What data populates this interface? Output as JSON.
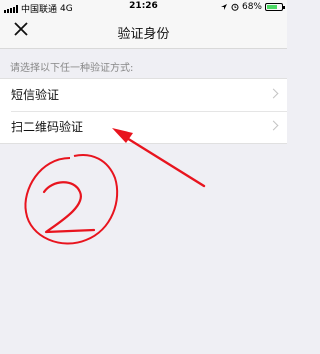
{
  "status_bar": {
    "carrier": "中国联通",
    "network": "4G",
    "time": "21:26",
    "battery": "68%",
    "battery_level": 0.68
  },
  "navbar": {
    "title": "验证身份",
    "close_icon": "close-icon"
  },
  "hint": "请选择以下任一种验证方式:",
  "options": [
    {
      "label": "短信验证"
    },
    {
      "label": "扫二维码验证"
    }
  ],
  "colors": {
    "background": "#efeff4",
    "annotation": "#e8141e",
    "battery": "#4cd964"
  }
}
